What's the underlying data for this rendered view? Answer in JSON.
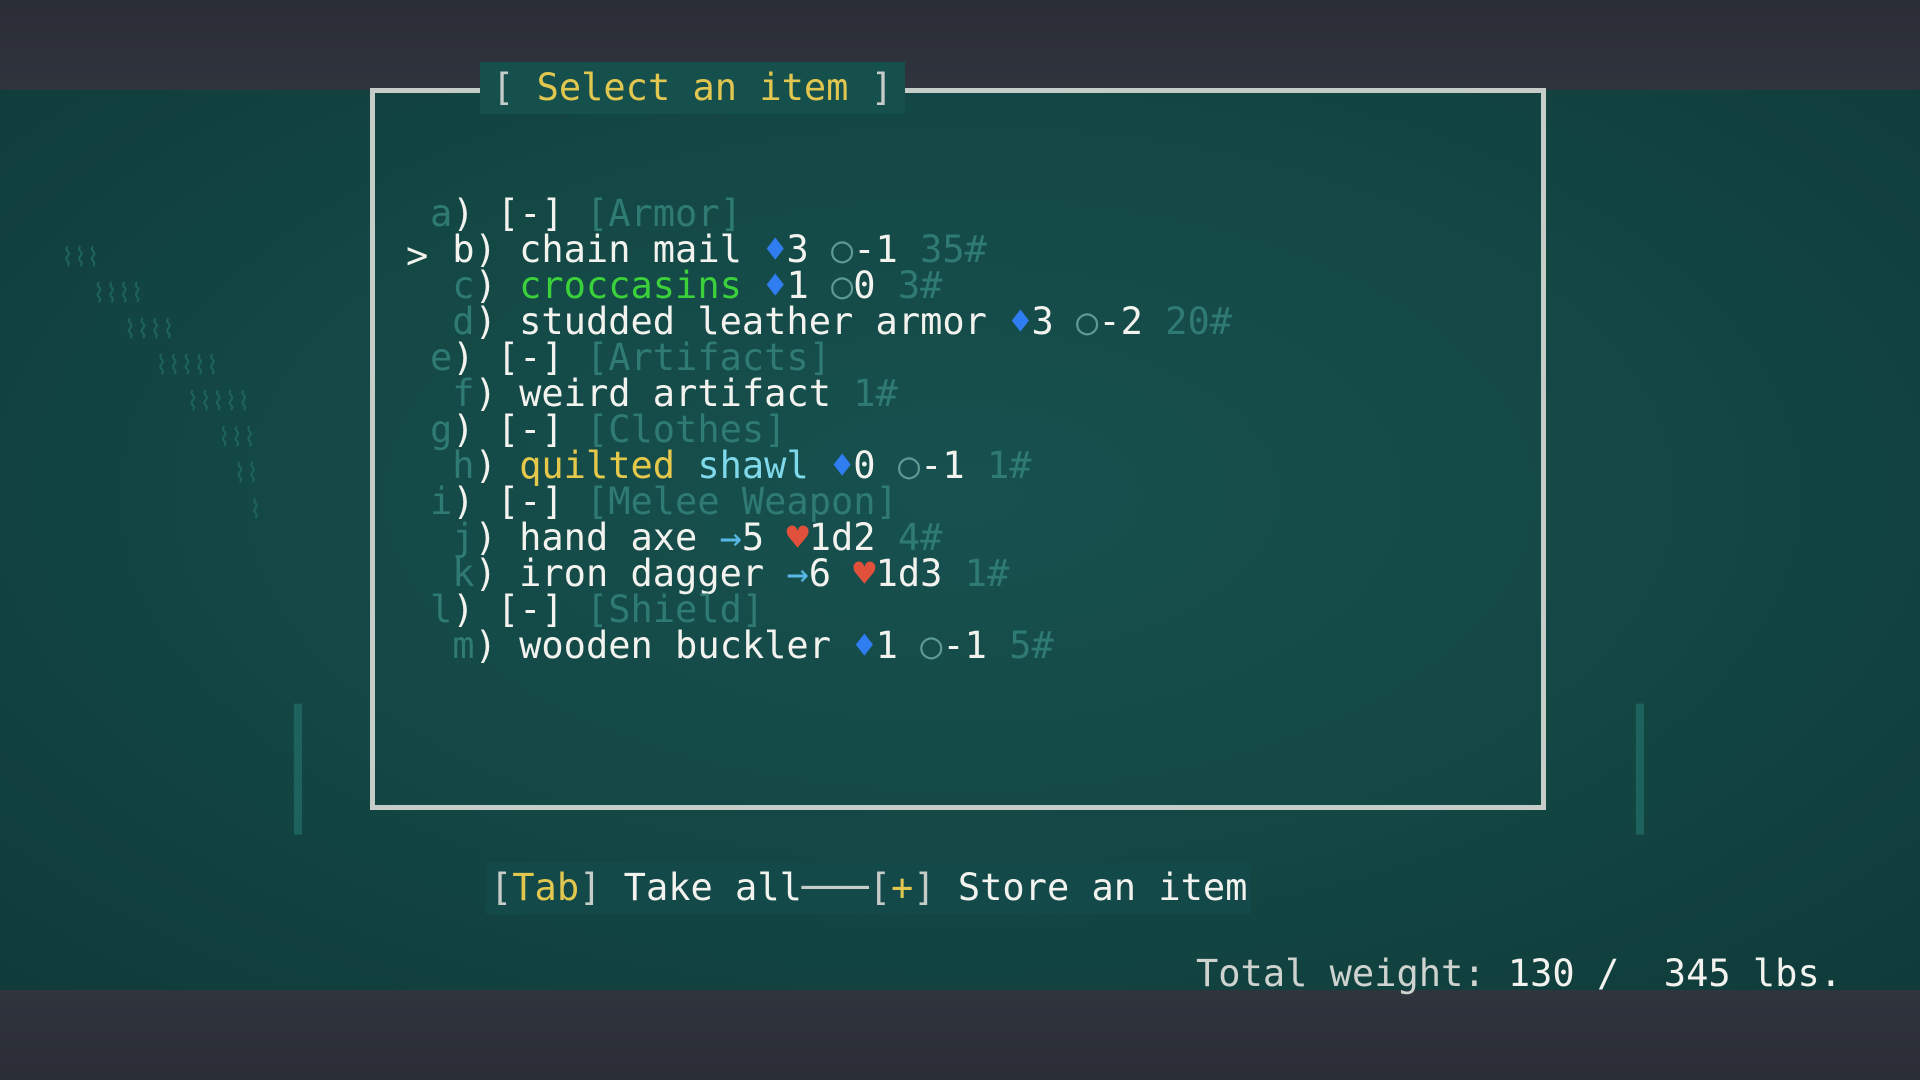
{
  "dialog": {
    "title": "Select an item",
    "cursor": ">"
  },
  "categories": [
    {
      "key": "a",
      "label": "[Armor]"
    },
    {
      "key": "e",
      "label": "[Artifacts]"
    },
    {
      "key": "g",
      "label": "[Clothes]"
    },
    {
      "key": "i",
      "label": "[Melee Weapon]"
    },
    {
      "key": "l",
      "label": "[Shield]"
    }
  ],
  "items": [
    {
      "key": "b",
      "name": "chain mail",
      "av": "3",
      "dv": "-1",
      "weight": "35#"
    },
    {
      "key": "c",
      "name": "croccasins",
      "av": "1",
      "dv": "0",
      "weight": "3#"
    },
    {
      "key": "d",
      "name": "studded leather armor",
      "av": "3",
      "dv": "-2",
      "weight": "20#"
    },
    {
      "key": "f",
      "name": "weird artifact",
      "weight": "1#"
    },
    {
      "key": "h",
      "name_part1": "quilted",
      "name_part2": "shawl",
      "av": "0",
      "dv": "-1",
      "weight": "1#"
    },
    {
      "key": "j",
      "name": "hand axe",
      "hit": "5",
      "dmg": "1d2",
      "weight": "4#"
    },
    {
      "key": "k",
      "name": "iron dagger",
      "hit": "6",
      "dmg": "1d3",
      "weight": "1#"
    },
    {
      "key": "m",
      "name": "wooden buckler",
      "av": "1",
      "dv": "-1",
      "weight": "5#"
    }
  ],
  "footer": {
    "take_all_key": "Tab",
    "take_all_label": "Take all",
    "store_key": "+",
    "store_label": "Store an item"
  },
  "status": {
    "weight_label": "Total weight:",
    "weight_value": "130 /  345 lbs."
  },
  "colors": {
    "background": "#134744",
    "frame": "#c6ccc8",
    "title": "#e1c64f",
    "text": "#f2f2ee",
    "dim": "#2f7a73",
    "green_item": "#3ad13a",
    "yellow_item": "#e6c94a",
    "cyan_item": "#7fd9ea",
    "armor_icon": "#2f7df0",
    "damage_icon": "#e0503a"
  },
  "icons": {
    "armor_value": "diamond-icon",
    "defense_value": "circle-icon",
    "to_hit": "arrow-right-icon",
    "damage": "heart-icon"
  }
}
